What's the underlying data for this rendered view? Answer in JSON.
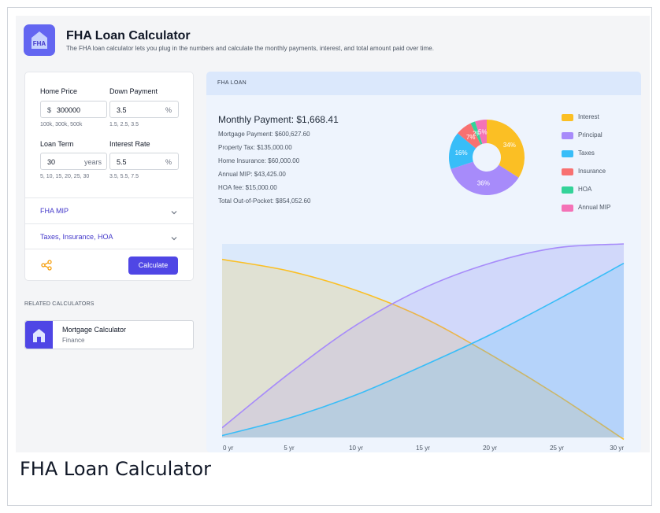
{
  "app": {
    "logo_text": "FHA",
    "title": "FHA Loan Calculator",
    "subtitle": "The FHA loan calculator lets you plug in the numbers and calculate the monthly payments, interest, and total amount paid over time.",
    "caption": "FHA Loan Calculator"
  },
  "form": {
    "home_price": {
      "label": "Home Price",
      "prefix": "$",
      "value": "300000",
      "hint": "100k, 300k, 500k"
    },
    "down_payment": {
      "label": "Down Payment",
      "value": "3.5",
      "suffix": "%",
      "hint": "1.5, 2.5, 3.5"
    },
    "loan_term": {
      "label": "Loan Term",
      "value": "30",
      "suffix": "years",
      "hint": "5, 10, 15, 20, 25, 30"
    },
    "interest_rate": {
      "label": "Interest Rate",
      "value": "5.5",
      "suffix": "%",
      "hint": "3.5, 5.5, 7.5"
    },
    "accordions": [
      "FHA MIP",
      "Taxes, Insurance, HOA"
    ],
    "calculate_label": "Calculate"
  },
  "related": {
    "heading": "RELATED CALCULATORS",
    "items": [
      {
        "name": "Mortgage Calculator",
        "category": "Finance"
      }
    ]
  },
  "results": {
    "header": "FHA LOAN",
    "monthly_payment": "Monthly Payment: $1,668.41",
    "lines": [
      "Mortgage Payment: $600,627.60",
      "Property Tax: $135,000.00",
      "Home Insurance: $60,000.00",
      "Annual MIP: $43,425.00",
      "HOA fee: $15,000.00",
      "Total Out-of-Pocket: $854,052.60"
    ]
  },
  "colors": {
    "accent": "#4f46e5",
    "interest": "#fbbf24",
    "principal": "#a78bfa",
    "taxes": "#38bdf8",
    "insurance": "#f87171",
    "hoa": "#34d399",
    "annual_mip": "#f472b6"
  },
  "chart_data": [
    {
      "type": "pie",
      "labels": [
        "Interest",
        "Principal",
        "Taxes",
        "Insurance",
        "HOA",
        "Annual MIP"
      ],
      "values": [
        34,
        36,
        16,
        7,
        2,
        5
      ],
      "value_labels": [
        "34%",
        "36%",
        "16%",
        "7%",
        "2%",
        "5%"
      ],
      "colors": [
        "#fbbf24",
        "#a78bfa",
        "#38bdf8",
        "#f87171",
        "#34d399",
        "#f472b6"
      ],
      "donut": true,
      "legend": "right"
    },
    {
      "type": "area",
      "x": [
        0,
        5,
        10,
        15,
        20,
        25,
        30
      ],
      "x_tick_labels": [
        "0 yr",
        "5 yr",
        "10 yr",
        "15 yr",
        "20 yr",
        "25 yr",
        "30 yr"
      ],
      "series": [
        {
          "name": "Interest",
          "color": "#fbbf24",
          "values": [
            0.92,
            0.86,
            0.76,
            0.62,
            0.43,
            0.22,
            -0.01
          ]
        },
        {
          "name": "Principal",
          "color": "#a78bfa",
          "values": [
            0.05,
            0.33,
            0.58,
            0.77,
            0.9,
            0.98,
            1.0
          ]
        },
        {
          "name": "Taxes",
          "color": "#38bdf8",
          "values": [
            0.01,
            0.1,
            0.22,
            0.37,
            0.53,
            0.71,
            0.9
          ]
        }
      ],
      "ylim": [
        0,
        1
      ],
      "grid": false
    }
  ]
}
